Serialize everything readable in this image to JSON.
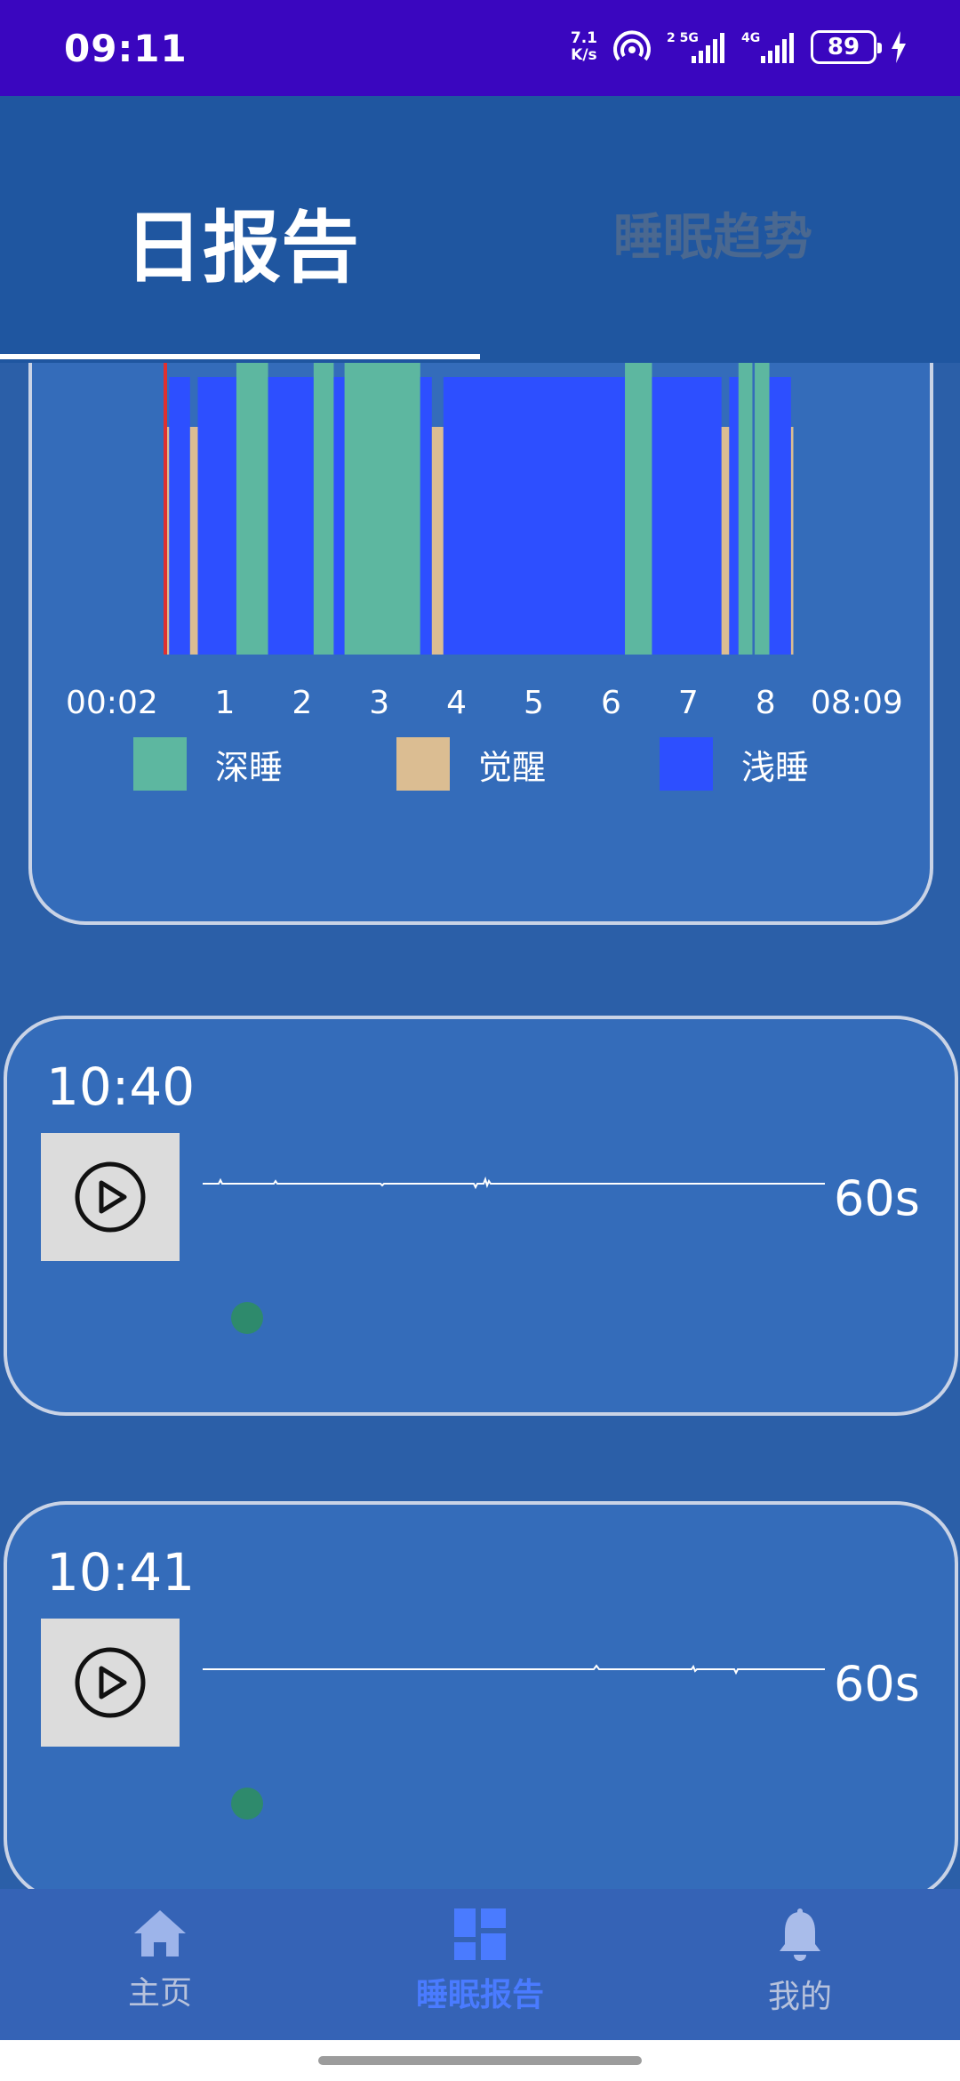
{
  "status_bar": {
    "time": "09:11",
    "net_speed_value": "7.1",
    "net_speed_unit": "K/s",
    "battery": "89"
  },
  "tabs": {
    "daily": "日报告",
    "trend": "睡眠趋势"
  },
  "chart_data": {
    "type": "bar",
    "start_label": "00:02",
    "end_label": "08:09",
    "x_ticks": [
      "1",
      "2",
      "3",
      "4",
      "5",
      "6",
      "7",
      "8"
    ],
    "stage_levels": {
      "深睡": 3,
      "浅睡": 2,
      "觉醒": 1
    },
    "segments": [
      {
        "stage": "觉醒",
        "start": 0.0,
        "end": 0.05
      },
      {
        "stage": "浅睡",
        "start": 0.05,
        "end": 0.32
      },
      {
        "stage": "觉醒",
        "start": 0.32,
        "end": 0.42
      },
      {
        "stage": "浅睡",
        "start": 0.42,
        "end": 0.92
      },
      {
        "stage": "深睡",
        "start": 0.92,
        "end": 1.33
      },
      {
        "stage": "浅睡",
        "start": 1.33,
        "end": 1.92
      },
      {
        "stage": "深睡",
        "start": 1.92,
        "end": 2.18
      },
      {
        "stage": "浅睡",
        "start": 2.18,
        "end": 2.32
      },
      {
        "stage": "深睡",
        "start": 2.32,
        "end": 3.3
      },
      {
        "stage": "浅睡",
        "start": 3.3,
        "end": 3.45
      },
      {
        "stage": "觉醒",
        "start": 3.45,
        "end": 3.6
      },
      {
        "stage": "浅睡",
        "start": 3.6,
        "end": 5.95
      },
      {
        "stage": "深睡",
        "start": 5.95,
        "end": 6.3
      },
      {
        "stage": "浅睡",
        "start": 6.3,
        "end": 7.2
      },
      {
        "stage": "觉醒",
        "start": 7.2,
        "end": 7.3
      },
      {
        "stage": "浅睡",
        "start": 7.3,
        "end": 7.42
      },
      {
        "stage": "深睡",
        "start": 7.42,
        "end": 7.6
      },
      {
        "stage": "深睡",
        "start": 7.63,
        "end": 7.82
      },
      {
        "stage": "浅睡",
        "start": 7.82,
        "end": 8.1
      },
      {
        "stage": "觉醒",
        "start": 8.1,
        "end": 8.13
      }
    ],
    "marker_x": 0.0,
    "colors": {
      "深睡": "#5db7a0",
      "觉醒": "#dbbd92",
      "浅睡": "#2d4fff",
      "marker": "#e03030"
    }
  },
  "legend": [
    {
      "label": "深睡",
      "color": "#5db7a0"
    },
    {
      "label": "觉醒",
      "color": "#dbbd92"
    },
    {
      "label": "浅睡",
      "color": "#2d4fff"
    }
  ],
  "recordings": [
    {
      "time": "10:40",
      "duration": "60s"
    },
    {
      "time": "10:41",
      "duration": "60s"
    }
  ],
  "bottom_nav": {
    "home": "主页",
    "report": "睡眠报告",
    "mine": "我的"
  }
}
